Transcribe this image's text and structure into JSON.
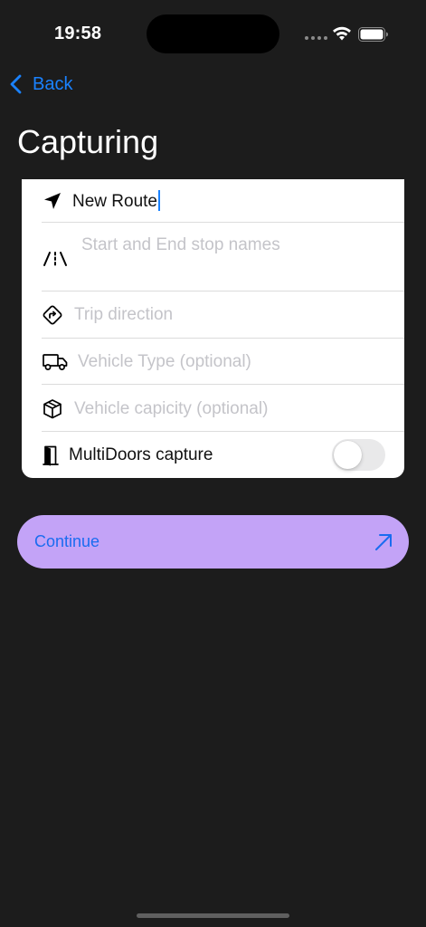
{
  "status_bar": {
    "time": "19:58"
  },
  "navigation": {
    "back_label": "Back",
    "title": "Capturing"
  },
  "form": {
    "route_name": {
      "icon": "location-arrow-icon",
      "value": "New Route"
    },
    "stop_names": {
      "icon": "road-icon",
      "placeholder": "Start and End stop names"
    },
    "trip_direction": {
      "icon": "direction-sign-icon",
      "placeholder": "Trip direction"
    },
    "vehicle_type": {
      "icon": "truck-icon",
      "placeholder": "Vehicle Type (optional)"
    },
    "vehicle_capacity": {
      "icon": "box-icon",
      "placeholder": "Vehicle capicity (optional)"
    },
    "multidoors": {
      "icon": "door-icon",
      "label": "MultiDoors capture",
      "enabled": false
    }
  },
  "continue_button": {
    "label": "Continue",
    "icon": "arrow-up-right-icon"
  },
  "colors": {
    "background": "#1c1c1c",
    "accent": "#1a82ff",
    "continue_background": "#c3a3f7",
    "continue_text": "#1a6cf0"
  }
}
